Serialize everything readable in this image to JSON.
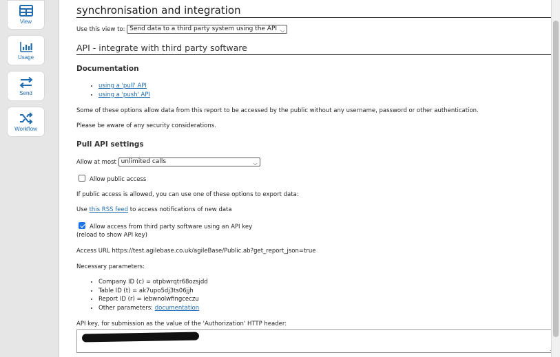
{
  "sidebar": {
    "items": [
      {
        "label": "View",
        "icon": "table-grid-icon"
      },
      {
        "label": "Usage",
        "icon": "bar-chart-icon"
      },
      {
        "label": "Send",
        "icon": "swap-arrows-icon"
      },
      {
        "label": "Workflow",
        "icon": "shuffle-icon"
      }
    ]
  },
  "header": {
    "title": "synchronisation and integration",
    "use_view_label": "Use this view to:",
    "use_view_select": "Send data to a third party system using the API"
  },
  "section": {
    "title": "API - integrate with third party software"
  },
  "documentation": {
    "heading": "Documentation",
    "links": [
      "using a 'pull' API",
      "using a 'push' API"
    ],
    "note1": "Some of these options allow data from this report to be accessed by the public without any username, password or other authentication.",
    "note2": "Please be aware of any security considerations."
  },
  "pull": {
    "heading": "Pull API settings",
    "allow_label": "Allow at most",
    "allow_select": "unlimited calls",
    "public_access_label": "Allow public access",
    "public_access_checked": false,
    "export_note": "If public access is allowed, you can use one of these options to export data:",
    "rss_prefix": "Use",
    "rss_link": "this RSS feed",
    "rss_suffix": "to access notifications of new data",
    "api_key_label": "Allow access from third party software using an API key",
    "api_key_checked": true,
    "reload_note": "(reload to show API key)",
    "access_url_label": "Access URL",
    "access_url": "https://test.agilebase.co.uk/agileBase/Public.ab?get_report_json=true",
    "params_label": "Necessary parameters:",
    "params": [
      "Company ID (c) = otpbwrqtr68ozsjdd",
      "Table ID (t) = ak7upo5dj3ts06jjh",
      "Report ID (r) = iebwnolwfingceczu"
    ],
    "other_params_prefix": "Other parameters:",
    "other_params_link": "documentation",
    "api_key_header_note": "API key, for submission as the value of the 'Authorization' HTTP header:"
  },
  "colors": {
    "link": "#1f6bb0",
    "checkbox_on": "#1a73e8",
    "sidebar_bg": "#e6e6e6"
  }
}
